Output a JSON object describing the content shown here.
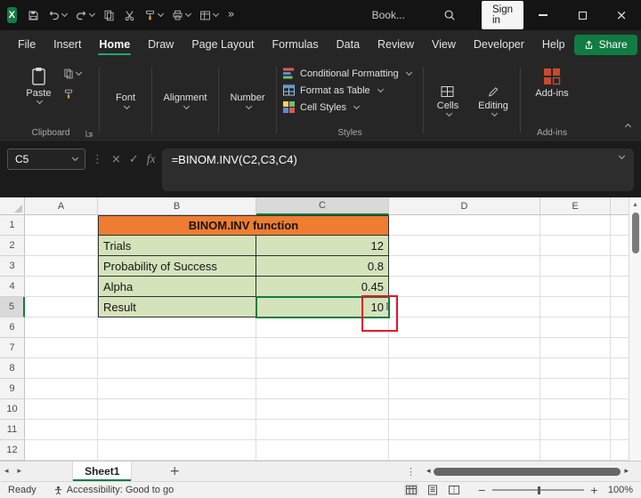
{
  "titlebar": {
    "workbook_label": "Book...",
    "signin_label": "Sign in"
  },
  "menu": {
    "tabs": [
      "File",
      "Insert",
      "Home",
      "Draw",
      "Page Layout",
      "Formulas",
      "Data",
      "Review",
      "View",
      "Developer",
      "Help"
    ],
    "active_tab": "Home",
    "share_label": "Share"
  },
  "ribbon": {
    "paste_label": "Paste",
    "font_label": "Font",
    "alignment_label": "Alignment",
    "number_label": "Number",
    "conditional_formatting_label": "Conditional Formatting",
    "format_as_table_label": "Format as Table",
    "cell_styles_label": "Cell Styles",
    "cells_label": "Cells",
    "editing_label": "Editing",
    "addins_button_label": "Add-ins",
    "group_labels": {
      "clipboard": "Clipboard",
      "styles": "Styles",
      "addins": "Add-ins"
    }
  },
  "formula_bar": {
    "name_box": "C5",
    "fx_label": "fx",
    "formula": "=BINOM.INV(C2,C3,C4)"
  },
  "grid": {
    "column_headers": [
      "A",
      "B",
      "C",
      "D",
      "E"
    ],
    "row_headers": [
      "1",
      "2",
      "3",
      "4",
      "5",
      "6",
      "7",
      "8",
      "9",
      "10",
      "11",
      "12"
    ],
    "selected_cell": "C5",
    "table": {
      "title": "BINOM.INV function",
      "rows": [
        {
          "label": "Trials",
          "value": "12"
        },
        {
          "label": "Probability of Success",
          "value": "0.8"
        },
        {
          "label": "Alpha",
          "value": "0.45"
        },
        {
          "label": "Result",
          "value": "10"
        }
      ]
    },
    "colors": {
      "table_header_fill": "#ED7D31",
      "table_row_fill": "#D5E3BB",
      "selection_border": "#107C41",
      "annotation_border": "#E8112D"
    }
  },
  "sheet_bar": {
    "tab_label": "Sheet1"
  },
  "status_bar": {
    "ready_label": "Ready",
    "accessibility_label": "Accessibility: Good to go",
    "zoom_label": "100%"
  },
  "ui_colors": {
    "excel_green": "#107C41"
  },
  "glyphs": {
    "logo_letter": "X",
    "more_commands": "»",
    "vertical_dots": "⋮",
    "cancel": "×",
    "confirm": "✓",
    "close": "×",
    "nav_left": "◂",
    "nav_right": "▸",
    "scroll_up": "▴",
    "add_sheet": "+",
    "zoom_out": "−",
    "zoom_in": "+"
  }
}
